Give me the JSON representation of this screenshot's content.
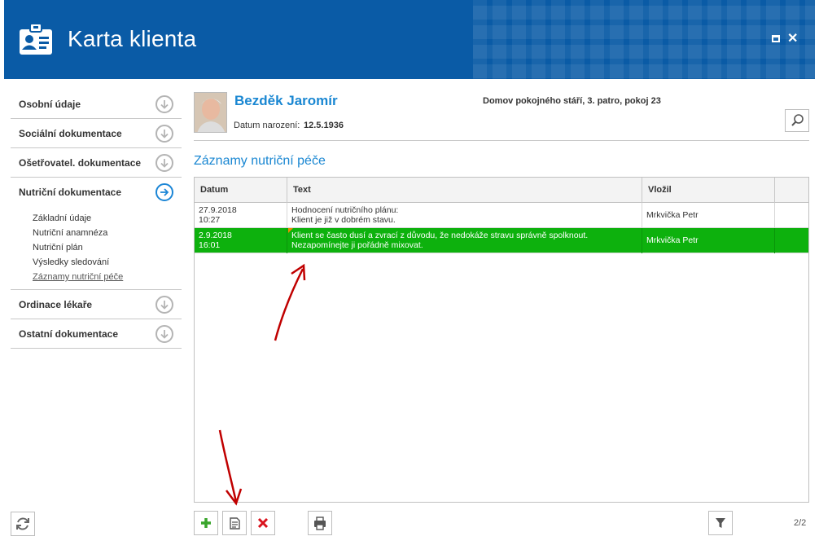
{
  "window": {
    "title": "Karta klienta"
  },
  "sidebar": {
    "sections": [
      {
        "label": "Osobní údaje"
      },
      {
        "label": "Sociální dokumentace"
      },
      {
        "label": "Ošetřovatel. dokumentace"
      },
      {
        "label": "Nutriční dokumentace",
        "active": true
      },
      {
        "label": "Ordinace lékaře"
      },
      {
        "label": "Ostatní dokumentace"
      }
    ],
    "subitems": [
      "Základní údaje",
      "Nutriční anamnéza",
      "Nutriční plán",
      "Výsledky sledování",
      "Záznamy nutriční péče"
    ]
  },
  "patient": {
    "name": "Bezděk Jaromír",
    "dob_label": "Datum narození:",
    "dob": "12.5.1936",
    "location": "Domov pokojného stáří, 3. patro, pokoj 23"
  },
  "section": {
    "title": "Záznamy nutriční péče"
  },
  "table": {
    "columns": [
      "Datum",
      "Text",
      "Vložil"
    ],
    "rows": [
      {
        "date": "27.9.2018",
        "time": "10:27",
        "text1": "Hodnocení nutričního plánu:",
        "text2": "Klient je již v dobrém stavu.",
        "author": "Mrkvička Petr",
        "selected": false
      },
      {
        "date": "2.9.2018",
        "time": "16:01",
        "text1": "Klient se často dusí a zvrací z důvodu, že nedokáže stravu správně spolknout.",
        "text2": "Nezapomínejte ji pořádně mixovat.",
        "author": "Mrkvička Petr",
        "selected": true
      }
    ]
  },
  "pager": {
    "text": "2/2"
  },
  "colors": {
    "header": "#0a5ba6",
    "accent": "#1a87d2",
    "selected_row": "#0db10d",
    "annotation_arrow": "#c00000"
  },
  "icons": [
    "client-card-icon",
    "maximize-icon",
    "close-icon",
    "chevron-down-circle-icon",
    "arrow-right-circle-icon",
    "refresh-icon",
    "search-icon",
    "add-icon",
    "edit-icon",
    "delete-icon",
    "print-icon",
    "filter-icon"
  ]
}
